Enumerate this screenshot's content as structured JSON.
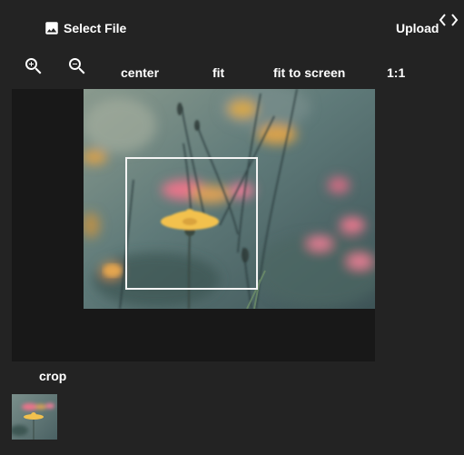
{
  "toolbar_top": {
    "select_file_label": "Select File",
    "upload_label": "Upload",
    "code_icon": "code-brackets-icon",
    "image_icon": "image-icon"
  },
  "zoom": {
    "zoom_in_icon": "zoom-in-icon",
    "zoom_out_icon": "zoom-out-icon",
    "center_label": "center",
    "fit_label": "fit",
    "fit_to_screen_label": "fit to screen",
    "one_to_one_label": "1:1"
  },
  "output": {
    "crop_label": "crop"
  },
  "colors": {
    "background": "#232323",
    "viewport_background": "#181818",
    "text": "#ffffff",
    "crop_border": "#f4f4f4"
  }
}
